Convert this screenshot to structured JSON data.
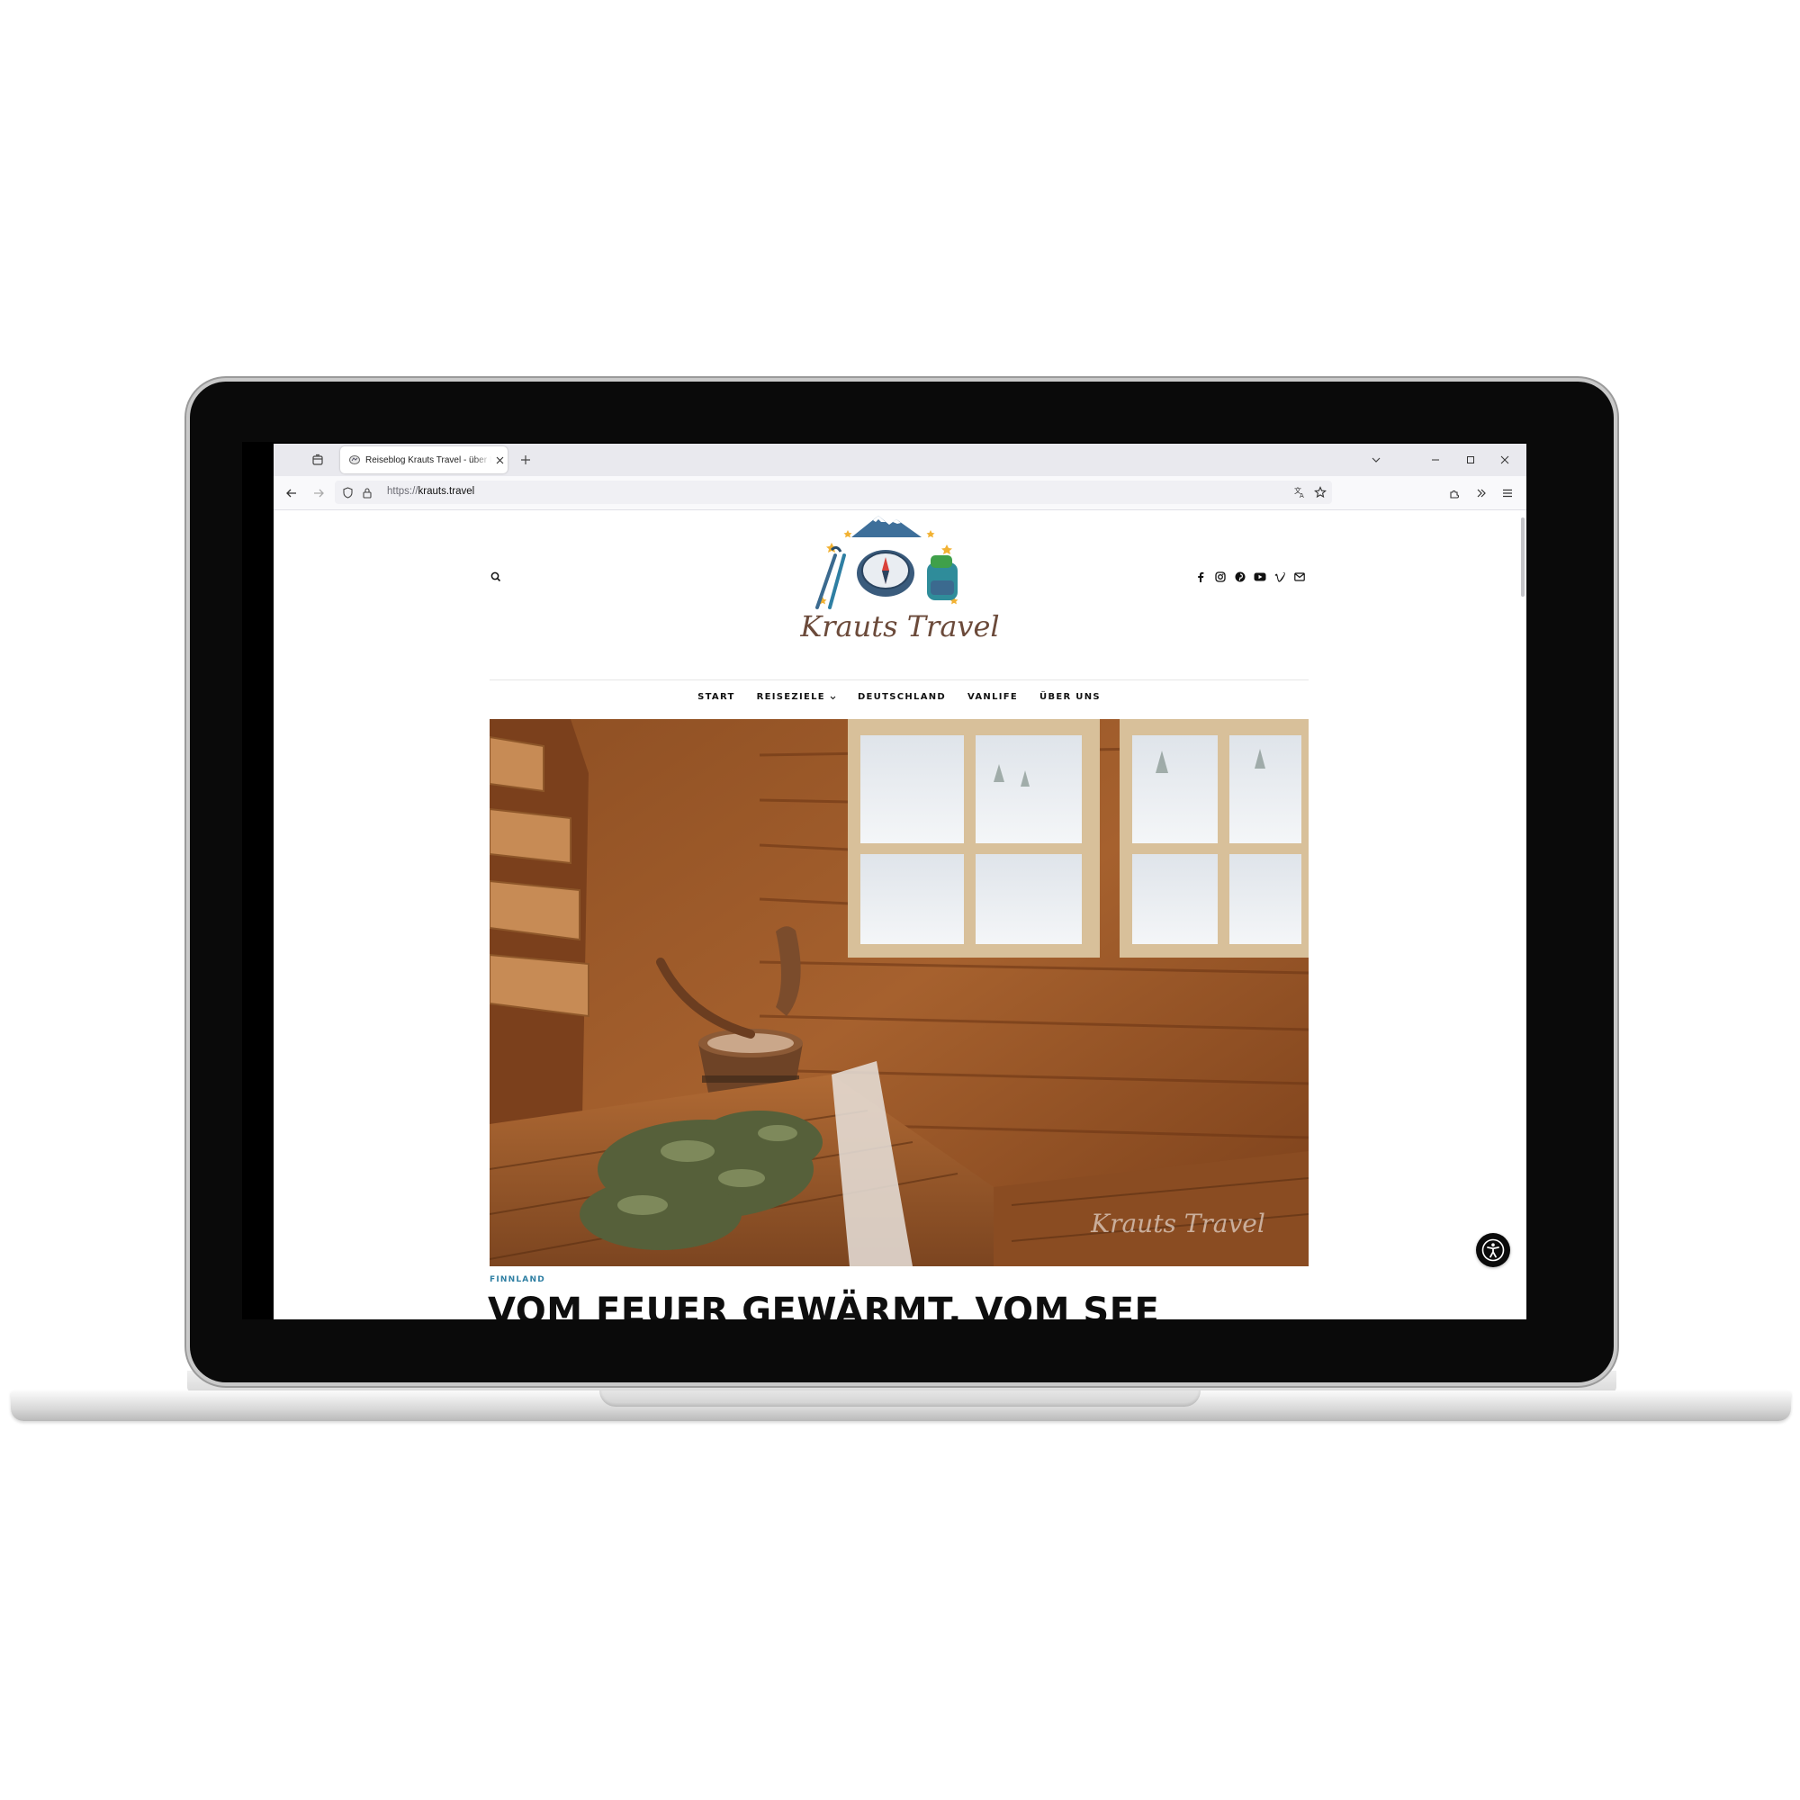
{
  "browser": {
    "tab_title": "Reiseblog Krauts Travel - über F",
    "url_scheme": "https://",
    "url_host": "krauts.travel",
    "icons": [
      "tab-list-icon",
      "favicon-icon",
      "close-icon",
      "plus-icon",
      "chevron-down-icon",
      "minimize-icon",
      "maximize-icon",
      "close-icon",
      "back-arrow-icon",
      "forward-arrow-icon",
      "shield-icon",
      "lock-icon",
      "translate-icon",
      "star-icon",
      "extensions-icon",
      "overflow-icon",
      "menu-icon"
    ]
  },
  "site": {
    "logo_text": "Krauts Travel",
    "nav": [
      {
        "label": "START"
      },
      {
        "label": "REISEZIELE",
        "has_dropdown": true
      },
      {
        "label": "DEUTSCHLAND"
      },
      {
        "label": "VANLIFE"
      },
      {
        "label": "ÜBER UNS"
      }
    ],
    "social_icons": [
      "facebook-icon",
      "instagram-icon",
      "pinterest-icon",
      "youtube-icon",
      "vimeo-icon",
      "email-icon"
    ],
    "hero_watermark": "Krauts Travel",
    "post": {
      "category": "FINNLAND",
      "title": "VOM FEUER GEWÄRMT, VOM SEE"
    }
  },
  "colors": {
    "accent": "#2f7fa3",
    "text": "#111111",
    "wood": "#9a5a2c",
    "tab_strip": "#e9e9ee"
  }
}
